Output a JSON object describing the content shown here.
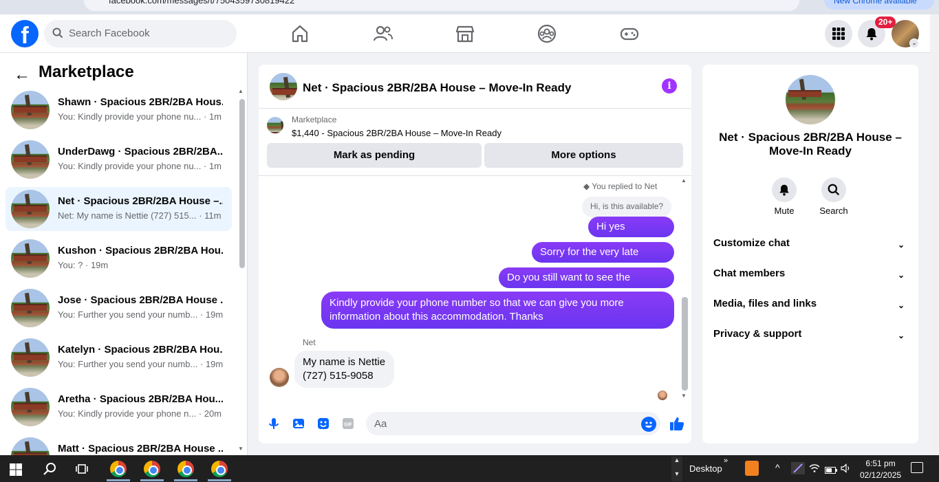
{
  "browser": {
    "url": "facebook.com/messages/t/7504359730819422",
    "update_label": "New Chrome available"
  },
  "topnav": {
    "search_placeholder": "Search Facebook",
    "notification_badge": "20+"
  },
  "left_panel": {
    "title": "Marketplace",
    "conversations": [
      {
        "title": "Shawn · Spacious 2BR/2BA Hous...",
        "preview": "You: Kindly provide your phone nu... · 1m"
      },
      {
        "title": "UnderDawg · Spacious 2BR/2BA...",
        "preview": "You: Kindly provide your phone nu... · 1m"
      },
      {
        "title": "Net · Spacious 2BR/2BA House –...",
        "preview": "Net: My name is Nettie (727) 515... · 11m",
        "active": true
      },
      {
        "title": "Kushon · Spacious 2BR/2BA Hou...",
        "preview": "You: ? · 19m"
      },
      {
        "title": "Jose · Spacious 2BR/2BA House ...",
        "preview": "You: Further you send your numb... · 19m"
      },
      {
        "title": "Katelyn · Spacious 2BR/2BA Hou...",
        "preview": "You: Further you send your numb... · 19m"
      },
      {
        "title": "Aretha · Spacious 2BR/2BA Hou...",
        "preview": "You: Kindly provide your phone n... · 20m"
      },
      {
        "title": "Matt · Spacious 2BR/2BA House ...",
        "preview": ""
      }
    ]
  },
  "chat": {
    "title": "Net · Spacious 2BR/2BA House – Move-In Ready",
    "marketplace_label": "Marketplace",
    "listing": "$1,440 - Spacious 2BR/2BA House – Move-In Ready",
    "mark_pending_label": "Mark as pending",
    "more_options_label": "More options",
    "replied_to": "You replied to Net",
    "quoted_message": "Hi, is this available?",
    "sent_messages": [
      "Hi yes available",
      "Sorry for the very late reply.",
      "Do you still want to see the house?",
      "Kindly provide your phone number so that we can give you more information about this accommodation. Thanks"
    ],
    "sender_name": "Net",
    "received_line1": "My name is Nettie",
    "received_line2": "(727) 515-9058",
    "input_placeholder": "Aa",
    "accent_color": "#7a2ef5"
  },
  "right_panel": {
    "title": "Net · Spacious 2BR/2BA House – Move-In Ready",
    "mute_label": "Mute",
    "search_label": "Search",
    "sections": [
      "Customize chat",
      "Chat members",
      "Media, files and links",
      "Privacy & support"
    ]
  },
  "taskbar": {
    "desktop_label": "Desktop",
    "time": "6:51 pm",
    "date": "02/12/2025"
  }
}
